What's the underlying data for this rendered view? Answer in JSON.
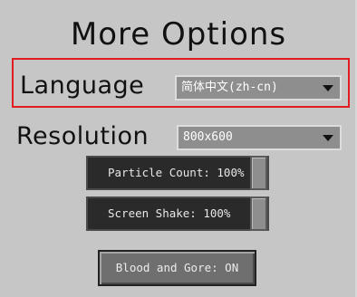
{
  "screen": {
    "title": "More Options"
  },
  "language": {
    "label": "Language",
    "selected": "简体中文(zh-cn)",
    "highlighted": true,
    "highlight_color": "#e11b22"
  },
  "resolution": {
    "label": "Resolution",
    "selected": "800x600"
  },
  "sliders": {
    "particle_count": {
      "label": "Particle Count: 100%",
      "value": 1.0
    },
    "screen_shake": {
      "label": "Screen Shake: 100%",
      "value": 1.0
    }
  },
  "buttons": {
    "blood_and_gore": "Blood and Gore: ON"
  },
  "icons": {
    "dropdown_arrow": "chevron-down-icon"
  },
  "colors": {
    "background": "#c6c6c6",
    "dropdown_bg": "#8e8e8e",
    "slider_bg": "#2a2a2a",
    "button_bg": "#6f6f6f"
  }
}
